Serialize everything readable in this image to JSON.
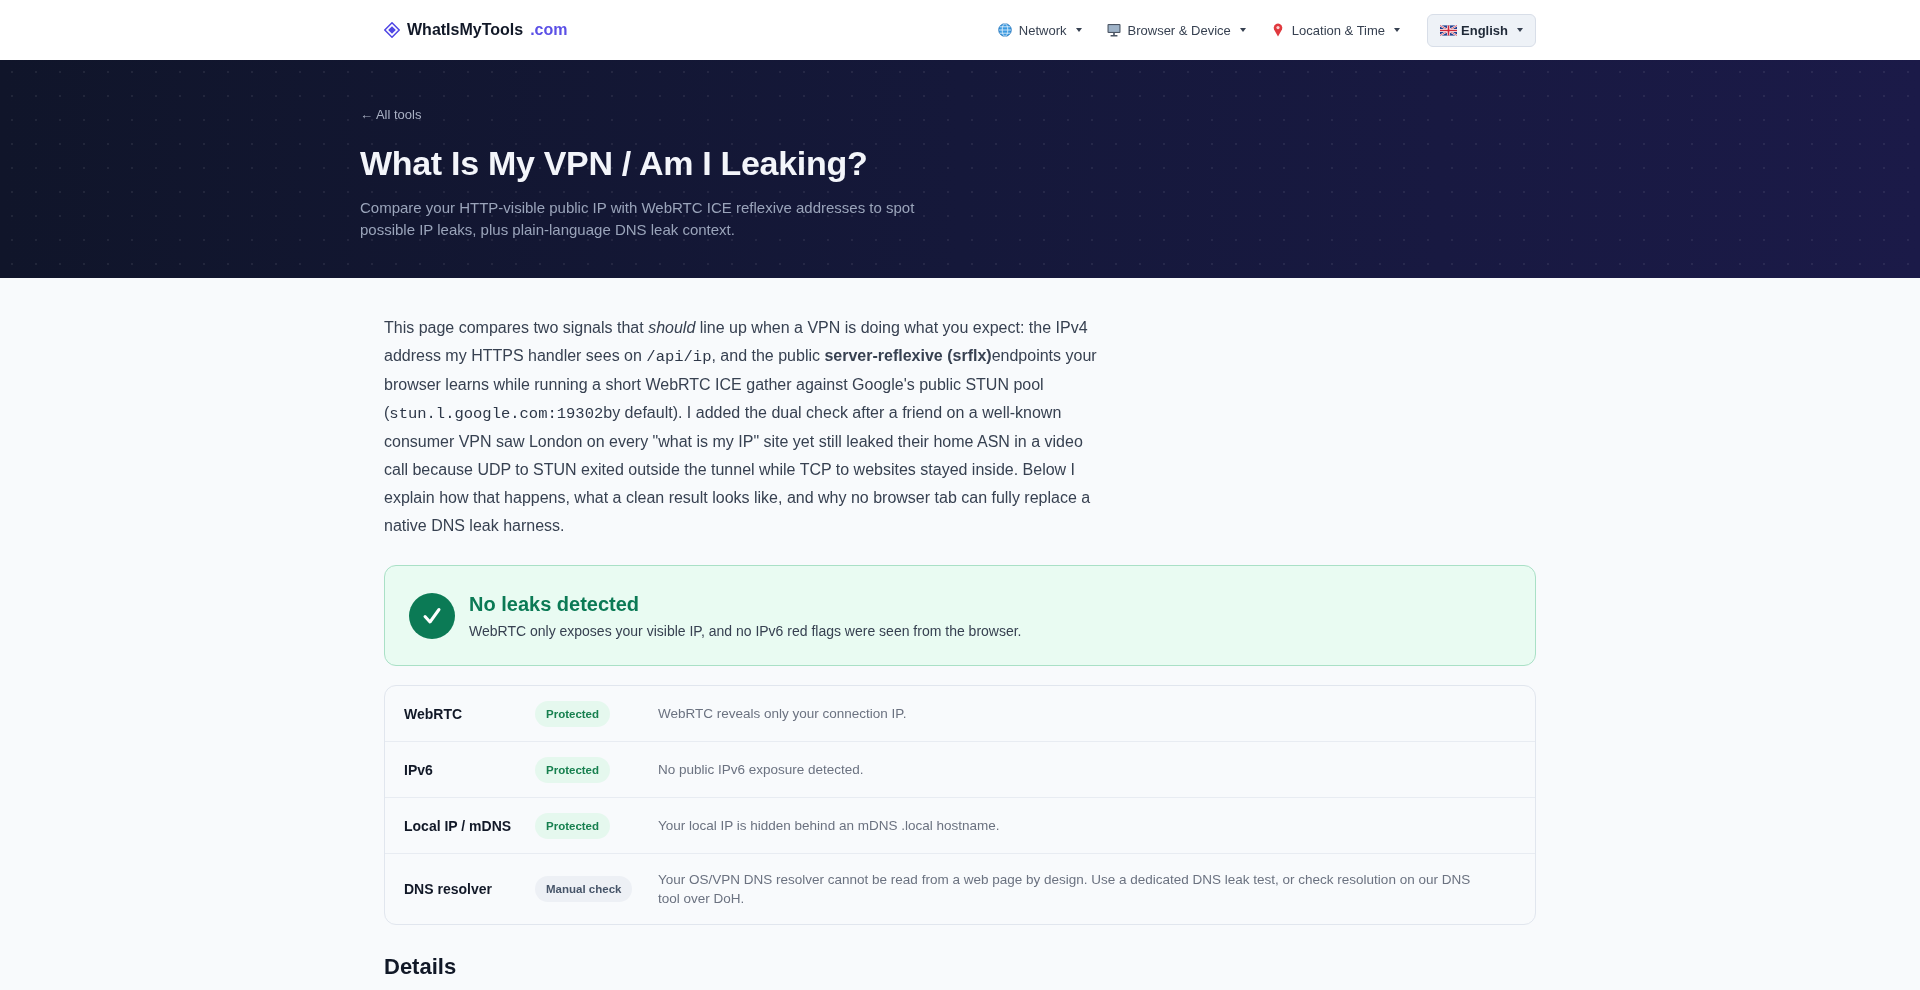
{
  "header": {
    "logo": {
      "name": "WhatIsMyTools",
      "suffix": ".com"
    },
    "nav": [
      {
        "label": "Network"
      },
      {
        "label": "Browser & Device"
      },
      {
        "label": "Location & Time"
      }
    ],
    "language": {
      "label": "English"
    }
  },
  "hero": {
    "back_link": "← All tools",
    "title": "What Is My VPN / Am I Leaking?",
    "subtitle": "Compare your HTTP-visible public IP with WebRTC ICE reflexive addresses to spot possible IP leaks, plus plain-language DNS leak context."
  },
  "intro": {
    "segments": [
      {
        "kind": "text",
        "text": "This page compares two signals that *should* line up when a VPN is doing what you expect: the IPv4 address my HTTPS handler sees on "
      },
      {
        "kind": "code",
        "text": "/api/ip"
      },
      {
        "kind": "text",
        "text": ", and the public **server-reflexive (srflx)**endpoints your browser learns while running a short WebRTC ICE gather against Google's public STUN pool ("
      },
      {
        "kind": "code",
        "text": "stun.l.google.com:19302"
      },
      {
        "kind": "text",
        "text": "by default). I added the dual check after a friend on a well-known consumer VPN saw London on every \"what is my IP\" site yet still leaked their home ASN in a video call because UDP to STUN exited outside the tunnel while TCP to websites stayed inside. Below I explain how that happens, what a clean result looks like, and why no browser tab can fully replace a native DNS leak harness."
      }
    ]
  },
  "status": {
    "title": "No leaks detected",
    "message": "WebRTC only exposes your visible IP, and no IPv6 red flags were seen from the browser."
  },
  "checks": [
    {
      "label": "WebRTC",
      "badge": {
        "text": "Protected",
        "kind": "protected"
      },
      "description": "WebRTC reveals only your connection IP."
    },
    {
      "label": "IPv6",
      "badge": {
        "text": "Protected",
        "kind": "protected"
      },
      "description": "No public IPv6 exposure detected."
    },
    {
      "label": "Local IP / mDNS",
      "badge": {
        "text": "Protected",
        "kind": "protected"
      },
      "description": "Your local IP is hidden behind an mDNS .local hostname."
    },
    {
      "label": "DNS resolver",
      "badge": {
        "text": "Manual check",
        "kind": "manual"
      },
      "description": "Your OS/VPN DNS resolver cannot be read from a web page by design. Use a dedicated DNS leak test, or check resolution on our DNS tool over DoH."
    }
  ],
  "details": {
    "heading": "Details"
  }
}
